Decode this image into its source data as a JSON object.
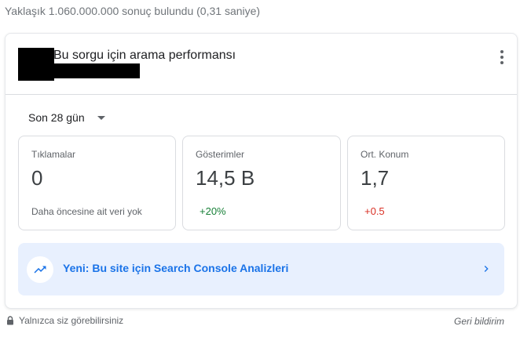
{
  "search": {
    "result_stats": "Yaklaşık 1.060.000.000 sonuç bulundu (0,31 saniye)"
  },
  "card": {
    "title": "Bu sorgu için arama performansı",
    "more_icon": "more-vert-icon",
    "date_range": {
      "selected": "Son 28 gün",
      "icon": "arrow-drop-down-icon"
    },
    "metrics": [
      {
        "label": "Tıklamalar",
        "value": "0",
        "note": "Daha öncesine ait veri yok"
      },
      {
        "label": "Gösterimler",
        "value": "14,5 B",
        "delta": "+20%",
        "delta_color": "#188038"
      },
      {
        "label": "Ort. Konum",
        "value": "1,7",
        "delta": "+0.5",
        "delta_color": "#d93025"
      }
    ],
    "banner": {
      "text": "Yeni: Bu site için Search Console Analizleri",
      "icon": "trending-up-icon",
      "chevron_icon": "chevron-right-icon",
      "accent": "#1a73e8",
      "background": "#e8f0fe"
    }
  },
  "footer": {
    "visibility": "Yalnızca siz görebilirsiniz",
    "lock_icon": "lock-icon",
    "feedback": "Geri bildirim"
  }
}
